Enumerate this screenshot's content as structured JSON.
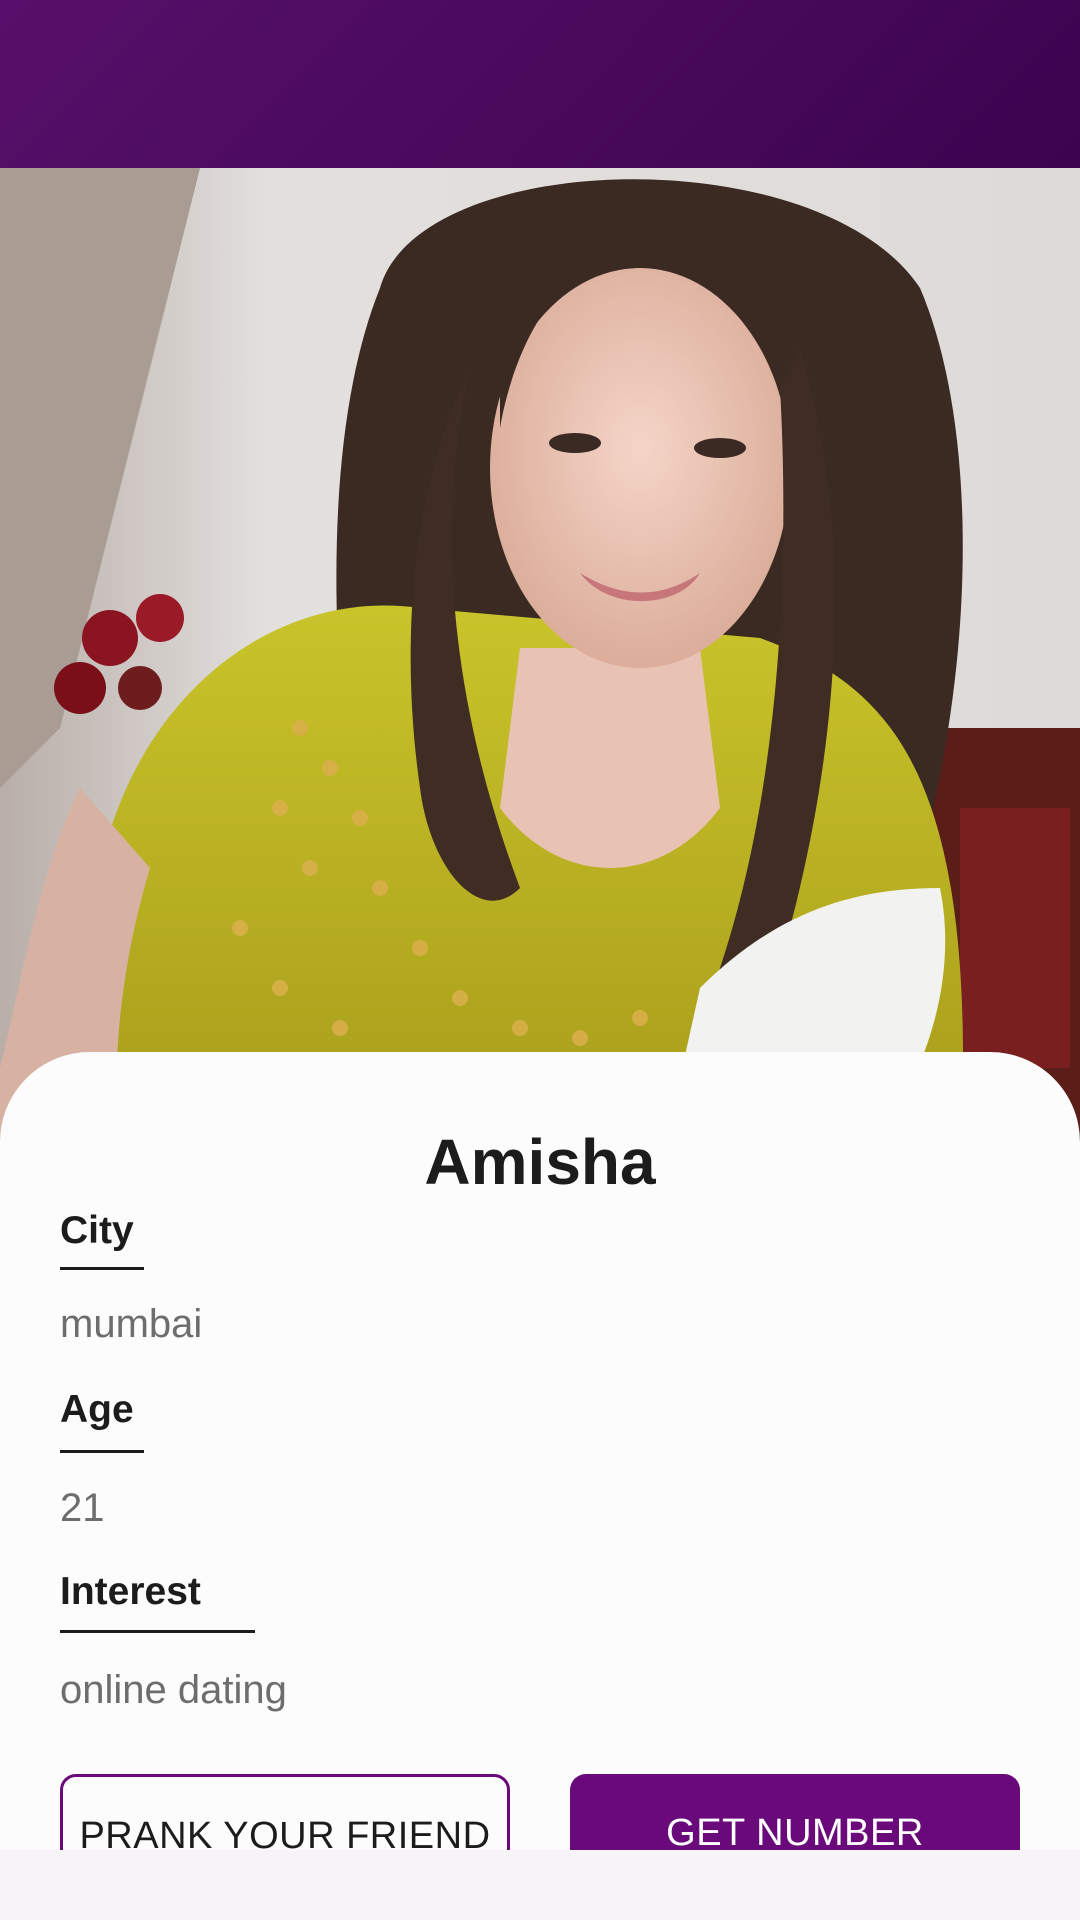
{
  "header": {
    "color_start": "#560f6a",
    "color_end": "#3b0350"
  },
  "photo": {
    "icon": "profile-photo"
  },
  "profile": {
    "name": "Amisha",
    "fields": [
      {
        "label": "City",
        "value": "mumbai"
      },
      {
        "label": "Age",
        "value": "21"
      },
      {
        "label": "Interest",
        "value": "online dating"
      }
    ]
  },
  "actions": {
    "prank_label": "PRANK YOUR FRIEND",
    "get_number_label": "GET NUMBER",
    "accent_color": "#6a0a7a"
  }
}
